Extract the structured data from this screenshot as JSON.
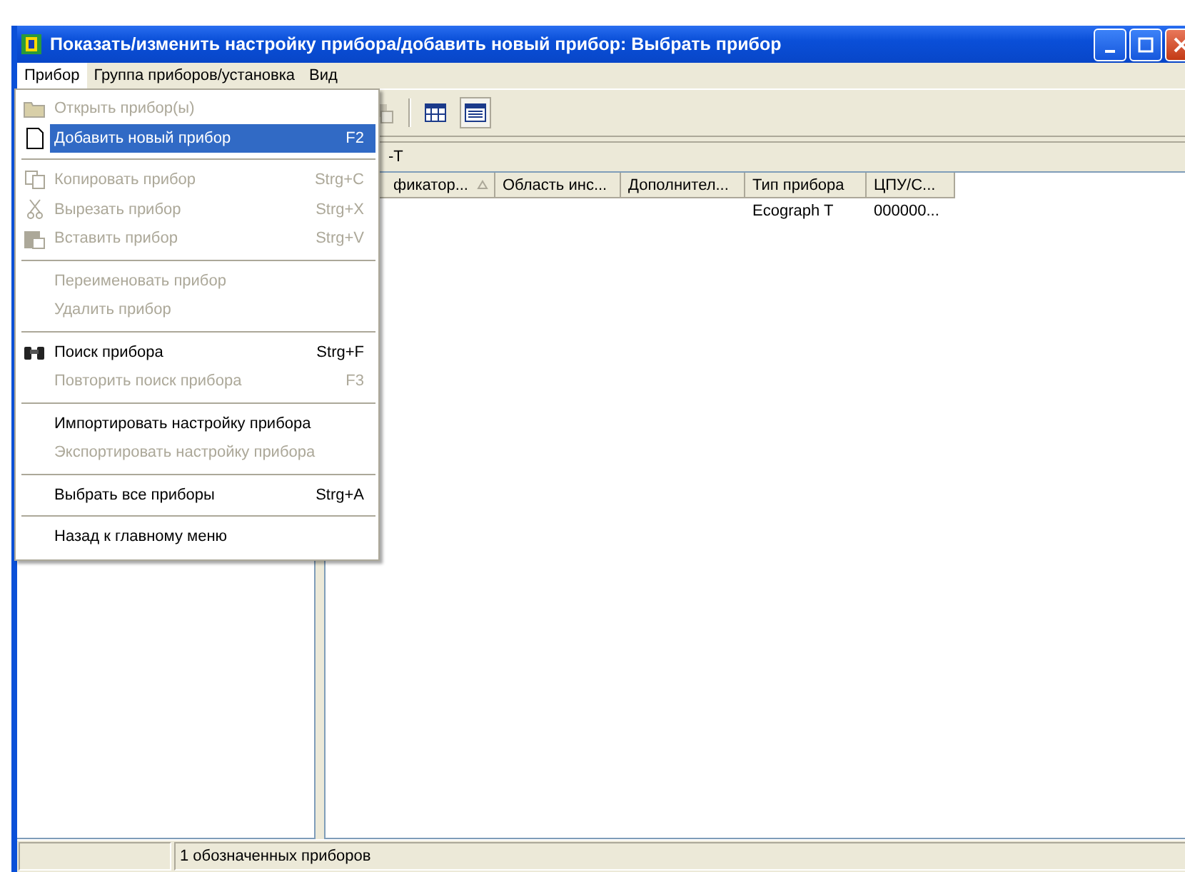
{
  "window": {
    "title": "Показать/изменить настройку прибора/добавить новый прибор: Выбрать прибор"
  },
  "menu_bar": [
    {
      "label": "Прибор",
      "selected": true
    },
    {
      "label": "Группа приборов/установка",
      "selected": false
    },
    {
      "label": "Вид",
      "selected": false
    }
  ],
  "dropdown": [
    {
      "kind": "item",
      "label": "Открыть прибор(ы)",
      "disabled": true,
      "selected": false
    },
    {
      "kind": "item",
      "label": "Добавить новый прибор",
      "shortcut": "F2",
      "disabled": false,
      "selected": true
    },
    {
      "kind": "separator"
    },
    {
      "kind": "item",
      "label": "Копировать прибор",
      "shortcut": "Strg+C",
      "disabled": true,
      "selected": false
    },
    {
      "kind": "item",
      "label": "Вырезать прибор",
      "shortcut": "Strg+X",
      "disabled": true,
      "selected": false
    },
    {
      "kind": "item",
      "label": "Вставить прибор",
      "shortcut": "Strg+V",
      "disabled": true,
      "selected": false
    },
    {
      "kind": "separator"
    },
    {
      "kind": "item",
      "label": "Переименовать прибор",
      "disabled": true,
      "selected": false
    },
    {
      "kind": "item",
      "label": "Удалить прибор",
      "disabled": true,
      "selected": false
    },
    {
      "kind": "separator"
    },
    {
      "kind": "item",
      "label": "Поиск прибора",
      "shortcut": "Strg+F",
      "disabled": false,
      "selected": false
    },
    {
      "kind": "item",
      "label": "Повторить поиск прибора",
      "shortcut": "F3",
      "disabled": true,
      "selected": false
    },
    {
      "kind": "separator"
    },
    {
      "kind": "item",
      "label": "Импортировать настройку прибора",
      "disabled": false,
      "selected": false
    },
    {
      "kind": "item",
      "label": "Экспортировать настройку прибора",
      "disabled": true,
      "selected": false
    },
    {
      "kind": "separator"
    },
    {
      "kind": "item",
      "label": "Выбрать все приборы",
      "shortcut": "Strg+A",
      "disabled": false,
      "selected": false
    },
    {
      "kind": "separator"
    },
    {
      "kind": "item",
      "label": "Назад к главному меню",
      "disabled": false,
      "selected": false
    }
  ],
  "toolbar": {
    "view_buttons": [
      {
        "selected": false
      },
      {
        "selected": true
      }
    ]
  },
  "path_bar": {
    "text": "-T"
  },
  "table": {
    "columns": [
      {
        "label": "фикатор...",
        "sorted": true
      },
      {
        "label": "Область инс...",
        "sorted": false
      },
      {
        "label": "Дополнител...",
        "sorted": false
      },
      {
        "label": "Тип прибора",
        "sorted": false
      },
      {
        "label": "ЦПУ/С...",
        "sorted": false
      }
    ],
    "rows": [
      {
        "cells": [
          null,
          null,
          null,
          "Ecograph T",
          "000000..."
        ]
      }
    ]
  },
  "status_bar": {
    "text": "1 обозначенных приборов"
  }
}
